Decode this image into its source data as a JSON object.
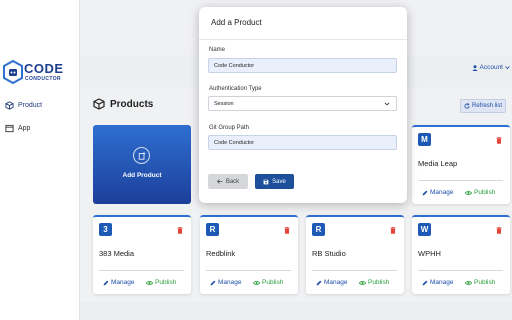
{
  "brand": {
    "line1": "CODE",
    "line2": "CONDUCTOR"
  },
  "sidebar": {
    "items": [
      {
        "label": "Product",
        "icon": "cube-icon"
      },
      {
        "label": "App",
        "icon": "window-icon"
      }
    ]
  },
  "header": {
    "account_label": "Account"
  },
  "products": {
    "title": "Products",
    "refresh_label": "Refresh list",
    "add_label": "Add Product",
    "cards": [
      {
        "badge": "M",
        "name": "Media Leap",
        "manage": "Manage",
        "publish": "Publish"
      },
      {
        "badge": "3",
        "name": "383 Media",
        "manage": "Manage",
        "publish": "Publish"
      },
      {
        "badge": "R",
        "name": "Redblink",
        "manage": "Manage",
        "publish": "Publish"
      },
      {
        "badge": "R",
        "name": "RB Studio",
        "manage": "Manage",
        "publish": "Publish"
      },
      {
        "badge": "W",
        "name": "WPHH",
        "manage": "Manage",
        "publish": "Publish"
      }
    ]
  },
  "modal": {
    "title": "Add a Product",
    "name_label": "Name",
    "name_value": "Code Conductor",
    "auth_label": "Authentication Type",
    "auth_value": "Session",
    "git_label": "Git Group Path",
    "git_value": "Code Conductor",
    "back_label": "Back",
    "save_label": "Save"
  },
  "colors": {
    "primary": "#1d4f9a",
    "accent": "#2f6fd1",
    "publish_green": "#2a9d3b",
    "delete_red": "#e0443a"
  }
}
